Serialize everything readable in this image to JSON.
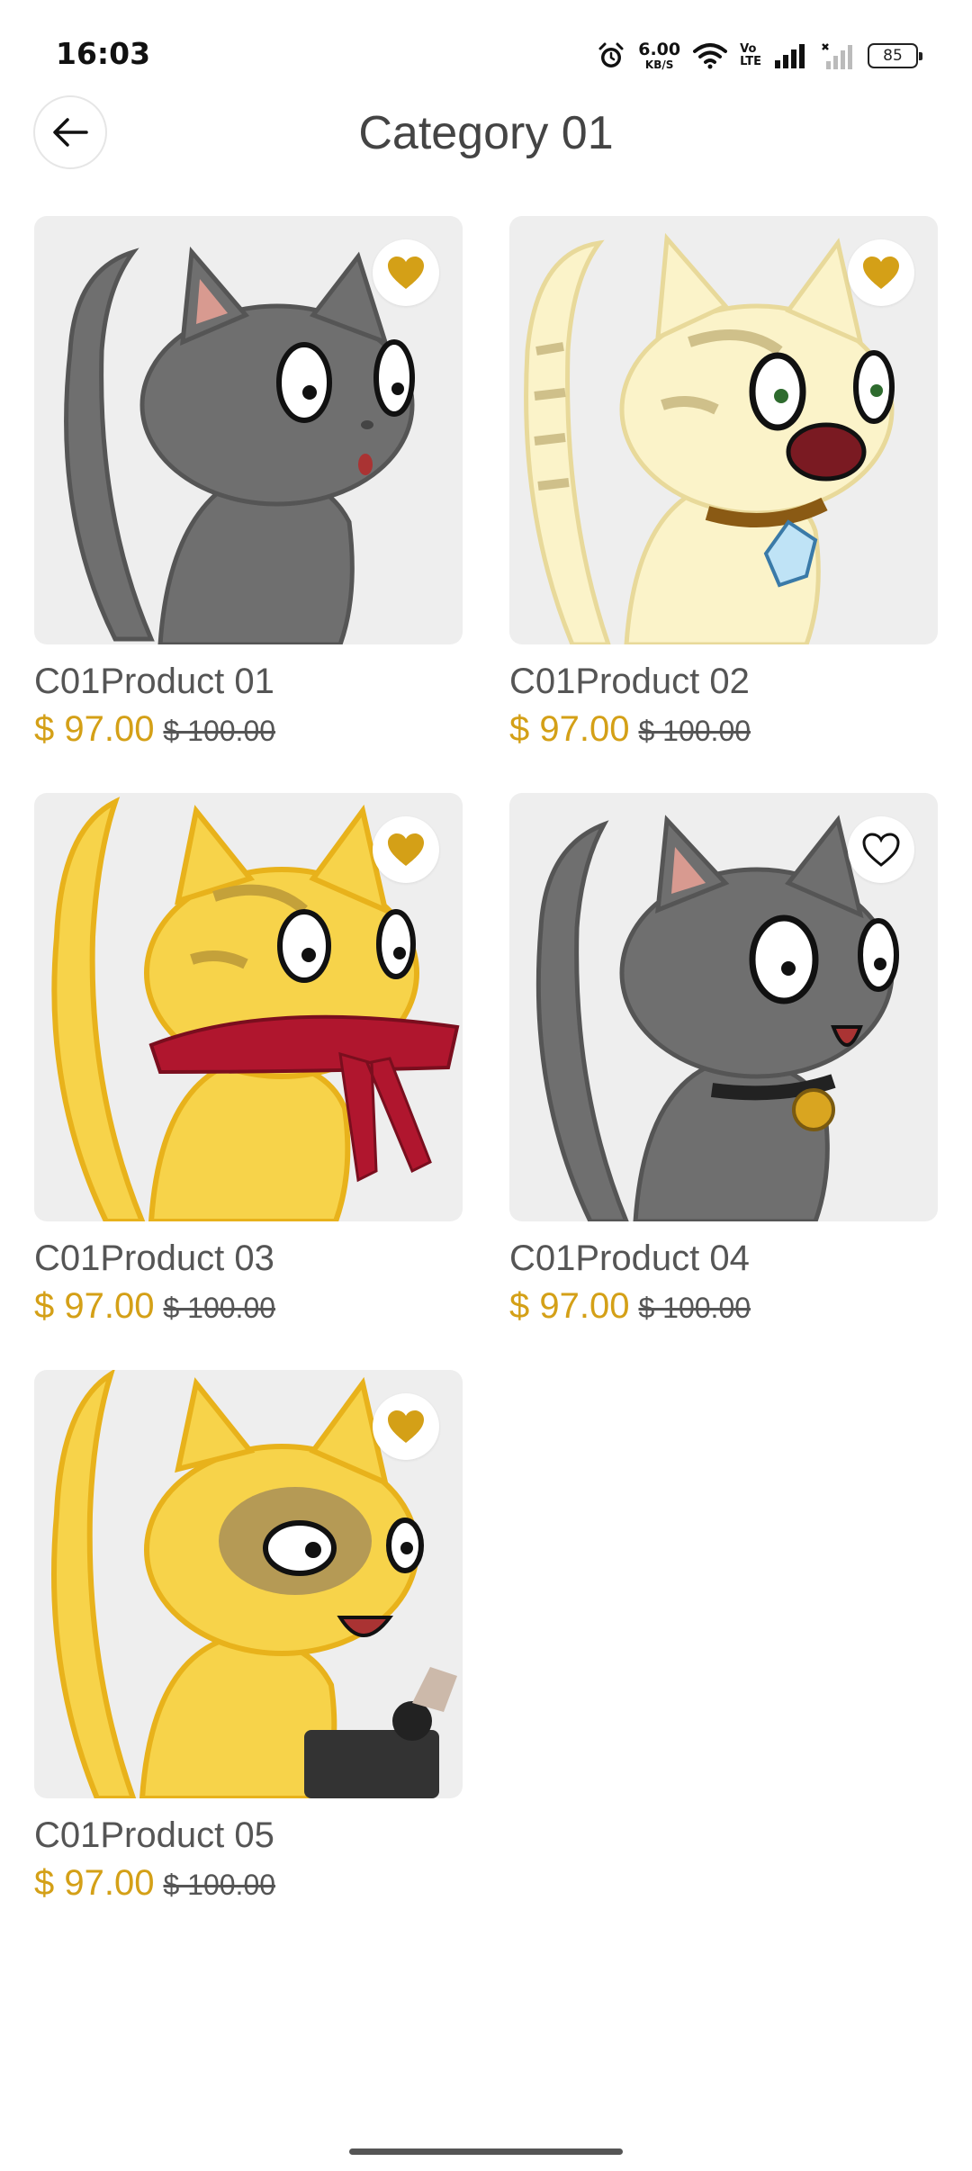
{
  "status_bar": {
    "time": "16:03",
    "net_speed_value": "6.00",
    "net_speed_unit": "KB/S",
    "volte_label": "Vo\nLTE",
    "battery_level": "85"
  },
  "header": {
    "title": "Category 01"
  },
  "colors": {
    "accent": "#d4a017",
    "card_bg": "#eeeeee"
  },
  "products": [
    {
      "name": "C01Product 01",
      "price": "$ 97.00",
      "old_price": "$ 100.00",
      "favorited": true,
      "image": "gray-cat-surprised"
    },
    {
      "name": "C01Product 02",
      "price": "$ 97.00",
      "old_price": "$ 100.00",
      "favorited": true,
      "image": "cream-tabby-cat-diamond-collar"
    },
    {
      "name": "C01Product 03",
      "price": "$ 97.00",
      "old_price": "$ 100.00",
      "favorited": true,
      "image": "yellow-cat-red-scarf"
    },
    {
      "name": "C01Product 04",
      "price": "$ 97.00",
      "old_price": "$ 100.00",
      "favorited": false,
      "image": "gray-cat-bell-collar"
    },
    {
      "name": "C01Product 05",
      "price": "$ 97.00",
      "old_price": "$ 100.00",
      "favorited": true,
      "image": "yellow-cat-typewriter"
    }
  ]
}
